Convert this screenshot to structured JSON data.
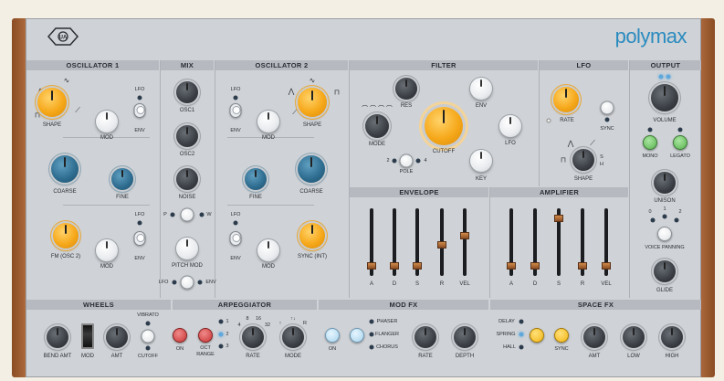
{
  "brand": {
    "name_bold": "poly",
    "name_light": "max",
    "logo": "ua-logo",
    "accent": "#2a8bbf"
  },
  "sections": {
    "osc1": "OSCILLATOR 1",
    "mix": "MIX",
    "osc2": "OSCILLATOR 2",
    "filter": "FILTER",
    "lfo": "LFO",
    "output": "OUTPUT",
    "envelope": "ENVELOPE",
    "amplifier": "AMPLIFIER",
    "wheels": "WHEELS",
    "arp": "ARPEGGIATOR",
    "modfx": "MOD FX",
    "spacefx": "SPACE FX"
  },
  "osc1": {
    "shape": "SHAPE",
    "mod": "MOD",
    "lfo": "LFO",
    "env": "ENV",
    "coarse": "COARSE",
    "fine": "FINE",
    "fm": "FM (OSC 2)",
    "mod2": "MOD",
    "lfo2": "LFO",
    "env2": "ENV"
  },
  "mix": {
    "osc1": "OSC1",
    "osc2": "OSC2",
    "noise": "NOISE",
    "p": "P",
    "w": "W",
    "pitchmod": "PITCH MOD",
    "lfo": "LFO",
    "env": "ENV"
  },
  "osc2": {
    "lfo": "LFO",
    "env": "ENV",
    "mod": "MOD",
    "shape": "SHAPE",
    "fine": "FINE",
    "coarse": "COARSE",
    "lfo2": "LFO",
    "env2": "ENV",
    "mod2": "MOD",
    "sync": "SYNC (INT)"
  },
  "filter": {
    "res": "RES",
    "env": "ENV",
    "mode": "MODE",
    "cutoff": "CUTOFF",
    "lfo": "LFO",
    "key": "KEY",
    "pole2": "2",
    "pole4": "4",
    "pole": "POLE"
  },
  "lfo": {
    "rate": "RATE",
    "sync": "SYNC",
    "shape": "SHAPE",
    "s": "S",
    "h": "H"
  },
  "output": {
    "volume": "VOLUME",
    "mono": "MONO",
    "legato": "LEGATO",
    "unison": "UNISON",
    "p0": "0",
    "p1": "1",
    "p2": "2",
    "panning": "VOICE PANNING",
    "glide": "GLIDE"
  },
  "envelope": {
    "labels": [
      "A",
      "D",
      "S",
      "R",
      "VEL"
    ],
    "levels": [
      0.1,
      0.1,
      0.1,
      0.45,
      0.6
    ]
  },
  "amplifier": {
    "labels": [
      "A",
      "D",
      "S",
      "R",
      "VEL"
    ],
    "levels": [
      0.1,
      0.1,
      0.9,
      0.1,
      0.1
    ]
  },
  "wheels": {
    "bendamt": "BEND AMT",
    "mod": "MOD",
    "amt": "AMT",
    "vibrato": "VIBRATO",
    "cutoff": "CUTOFF"
  },
  "arp": {
    "on": "ON",
    "oct": "OCT",
    "range": "RANGE",
    "r1": "1",
    "r2": "2",
    "r3": "3",
    "t4": "4",
    "t8": "8",
    "t16": "16",
    "t32": "32",
    "rate": "RATE",
    "m1": "↑",
    "m2": "↑↓",
    "mr": "R",
    "mode": "MODE"
  },
  "modfx": {
    "on": "ON",
    "phaser": "PHASER",
    "flanger": "FLANGER",
    "chorus": "CHORUS",
    "rate": "RATE",
    "depth": "DEPTH"
  },
  "spacefx": {
    "delay": "DELAY",
    "spring": "SPRING",
    "hall": "HALL",
    "sync": "SYNC",
    "amt": "AMT",
    "low": "LOW",
    "high": "HIGH"
  }
}
